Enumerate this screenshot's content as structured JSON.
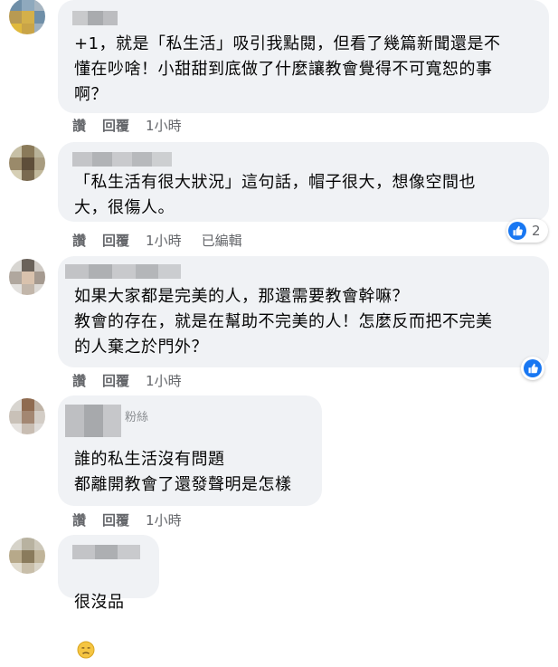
{
  "colors": {
    "bubble_bg": "#f0f2f5",
    "action_text": "#65676b",
    "like_blue": "#1877f2"
  },
  "comments": [
    {
      "text": "+1，就是「私生活」吸引我點閱，但看了幾篇新聞還是不\n懂在吵啥！小甜甜到底做了什麼讓教會覺得不可寬恕的事\n啊？",
      "actions": {
        "like": "讚",
        "reply": "回覆",
        "time": "1小時"
      }
    },
    {
      "text": "「私生活有很大狀況」這句話，帽子很大，想像空間也\n大，很傷人。",
      "actions": {
        "like": "讚",
        "reply": "回覆",
        "time": "1小時",
        "edited": "已編輯"
      },
      "reaction": {
        "icon": "like-icon",
        "count": "2"
      }
    },
    {
      "text": "如果大家都是完美的人，那還需要教會幹嘛？\n教會的存在，就是在幫助不完美的人！怎麼反而把不完美\n的人棄之於門外？",
      "actions": {
        "like": "讚",
        "reply": "回覆",
        "time": "1小時"
      },
      "reaction": {
        "icon": "like-icon"
      }
    },
    {
      "badge": "粉絲",
      "text": "誰的私生活沒有問題\n都離開教會了還發聲明是怎樣",
      "actions": {
        "like": "讚",
        "reply": "回覆",
        "time": "1小時"
      }
    },
    {
      "text": "很沒品",
      "emoji": "disappointed-face-icon"
    }
  ]
}
